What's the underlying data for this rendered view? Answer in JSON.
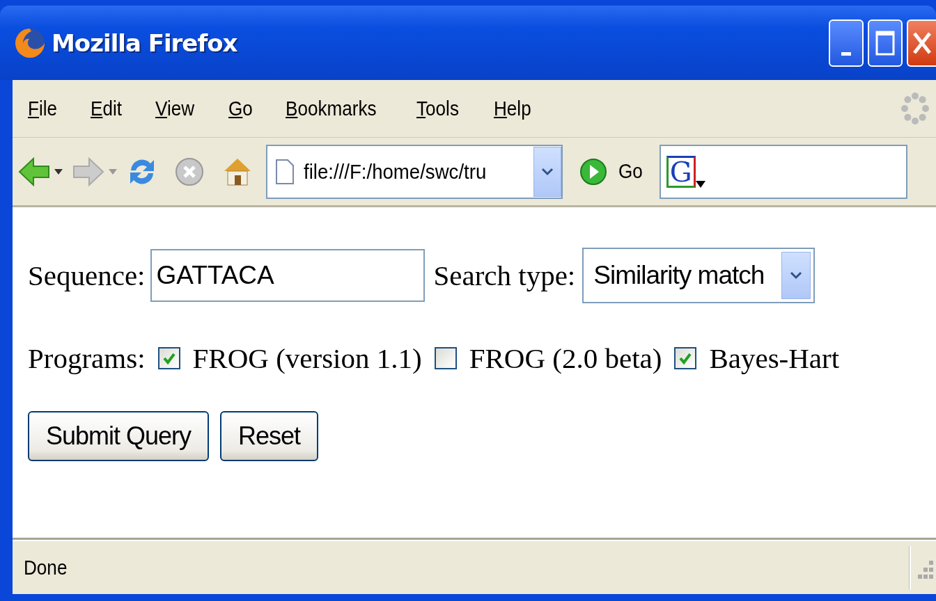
{
  "window": {
    "title": "Mozilla Firefox"
  },
  "menu": [
    "File",
    "Edit",
    "View",
    "Go",
    "Bookmarks",
    "Tools",
    "Help"
  ],
  "toolbar": {
    "address": "file:///F:/home/swc/tru",
    "go_label": "Go",
    "search_logo": "G"
  },
  "form": {
    "sequence_label": "Sequence:",
    "sequence_value": "GATTACA",
    "search_type_label": "Search type:",
    "search_type_value": "Similarity match",
    "programs_label": "Programs:",
    "programs": [
      {
        "label": "FROG (version 1.1)",
        "checked": true
      },
      {
        "label": "FROG (2.0 beta)",
        "checked": false
      },
      {
        "label": "Bayes-Hart",
        "checked": true
      }
    ],
    "buttons": [
      "Submit Query",
      "Reset"
    ]
  },
  "status_bar": {
    "text": "Done"
  }
}
